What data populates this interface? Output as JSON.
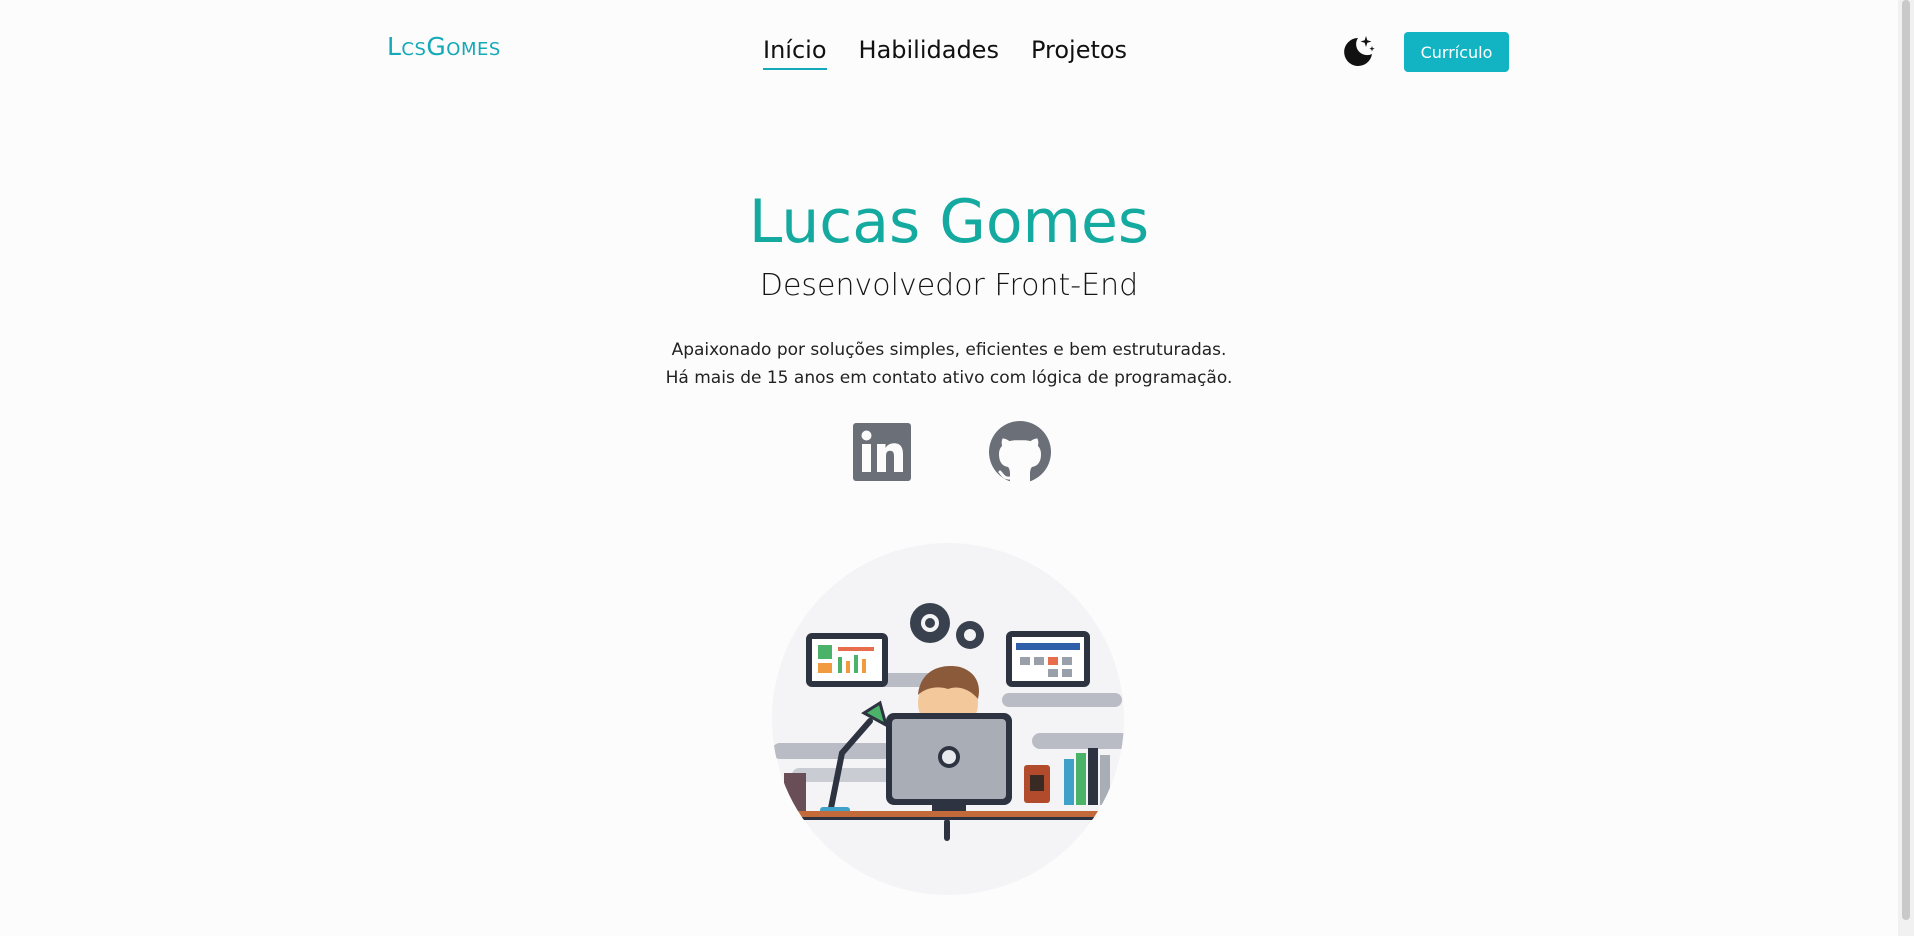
{
  "header": {
    "logo": "LcsGomes",
    "nav": [
      {
        "label": "Início",
        "active": true
      },
      {
        "label": "Habilidades",
        "active": false
      },
      {
        "label": "Projetos",
        "active": false
      }
    ],
    "theme_icon": "moon-stars-icon",
    "cv_button": "Currículo"
  },
  "hero": {
    "name": "Lucas Gomes",
    "role": "Desenvolvedor Front-End",
    "desc_line1": "Apaixonado por soluções simples, eficientes e bem estruturadas.",
    "desc_line2": "Há mais de 15 anos em contato ativo com lógica de programação."
  },
  "socials": [
    {
      "icon": "linkedin-icon"
    },
    {
      "icon": "github-icon"
    }
  ],
  "colors": {
    "accent": "#13a9b8",
    "name": "#14aaa0",
    "button": "#12b4c4",
    "icon_gray": "#6b7078"
  }
}
